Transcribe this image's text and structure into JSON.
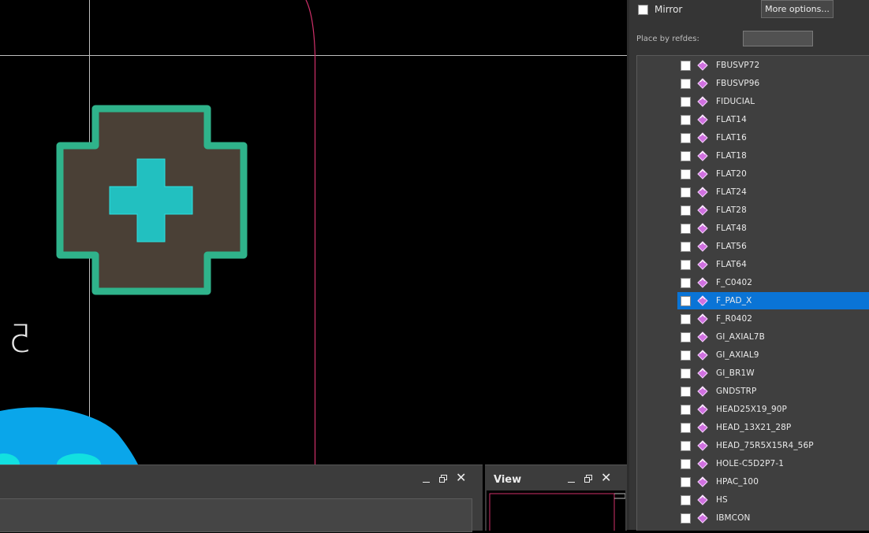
{
  "canvas": {
    "refdes_glyph": "5"
  },
  "bottom_panel": {
    "controls": [
      "minimize",
      "restore",
      "close"
    ]
  },
  "view_panel": {
    "title": "View"
  },
  "options": {
    "mirror_label": "Mirror",
    "mirror_checked": false,
    "more_options_label": "More options...",
    "place_by_refdes_label": "Place by refdes:",
    "place_by_refdes_value": ""
  },
  "symbol_list": {
    "selected": "F_PAD_X",
    "items": [
      {
        "name": "FBUSVP72"
      },
      {
        "name": "FBUSVP96"
      },
      {
        "name": "FIDUCIAL"
      },
      {
        "name": "FLAT14"
      },
      {
        "name": "FLAT16"
      },
      {
        "name": "FLAT18"
      },
      {
        "name": "FLAT20"
      },
      {
        "name": "FLAT24"
      },
      {
        "name": "FLAT28"
      },
      {
        "name": "FLAT48"
      },
      {
        "name": "FLAT56"
      },
      {
        "name": "FLAT64"
      },
      {
        "name": "F_C0402"
      },
      {
        "name": "F_PAD_X"
      },
      {
        "name": "F_R0402"
      },
      {
        "name": "GI_AXIAL7B"
      },
      {
        "name": "GI_AXIAL9"
      },
      {
        "name": "GI_BR1W"
      },
      {
        "name": "GNDSTRP"
      },
      {
        "name": "HEAD25X19_90P"
      },
      {
        "name": "HEAD_13X21_28P"
      },
      {
        "name": "HEAD_75R5X15R4_56P"
      },
      {
        "name": "HOLE-C5D2P7-1"
      },
      {
        "name": "HPAC_100"
      },
      {
        "name": "HS"
      },
      {
        "name": "IBMCON"
      }
    ]
  },
  "colors": {
    "pad_outline": "#2fb38b",
    "pad_fill": "#4a4036",
    "pad_cross": "#22c0c0",
    "grid_line": "#bfbfbf",
    "board_outline": "#d0306a",
    "blue_shape": "#0aa6ea",
    "selection": "#0a74d6",
    "symbol_icon": "#d070e0"
  }
}
